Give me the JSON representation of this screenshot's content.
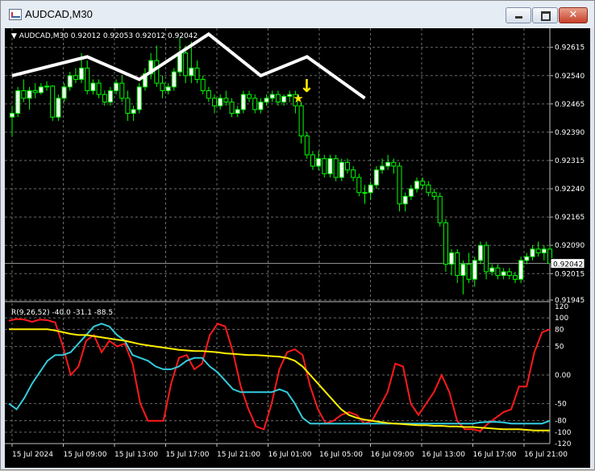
{
  "window": {
    "title": "AUDCAD,M30",
    "close_glyph": "✕"
  },
  "chart_data": [
    {
      "type": "candlestick",
      "symbol_header": "AUDCAD,M30  0.92012 0.92053 0.92012 0.92042",
      "current_price": "0.92042",
      "price_ticks": [
        "0.92615",
        "0.92540",
        "0.92465",
        "0.92390",
        "0.92315",
        "0.92240",
        "0.92165",
        "0.92090",
        "0.92015",
        "0.91945"
      ],
      "ylim": [
        0.91945,
        0.92655
      ],
      "up_color": "#ffffff",
      "down_color": "#000000",
      "wick_color": "#00ff00",
      "candles_ohlc": [
        [
          0.9243,
          0.9246,
          0.9238,
          0.9244
        ],
        [
          0.9244,
          0.9251,
          0.9243,
          0.925
        ],
        [
          0.925,
          0.9253,
          0.9247,
          0.9248
        ],
        [
          0.9248,
          0.9251,
          0.9245,
          0.925
        ],
        [
          0.925,
          0.9252,
          0.9248,
          0.92495
        ],
        [
          0.92495,
          0.9252,
          0.9249,
          0.9251
        ],
        [
          0.9251,
          0.92525,
          0.925,
          0.92512
        ],
        [
          0.92512,
          0.92515,
          0.9242,
          0.9243
        ],
        [
          0.9243,
          0.9249,
          0.9242,
          0.9248
        ],
        [
          0.9248,
          0.9252,
          0.9247,
          0.9251
        ],
        [
          0.9251,
          0.9255,
          0.925,
          0.9254
        ],
        [
          0.9254,
          0.9256,
          0.9252,
          0.9253
        ],
        [
          0.9253,
          0.926,
          0.9252,
          0.9256
        ],
        [
          0.9256,
          0.9258,
          0.9249,
          0.925
        ],
        [
          0.925,
          0.9253,
          0.9249,
          0.9252
        ],
        [
          0.9252,
          0.9253,
          0.9248,
          0.9249
        ],
        [
          0.9249,
          0.925,
          0.9246,
          0.9247
        ],
        [
          0.9247,
          0.9251,
          0.9246,
          0.925
        ],
        [
          0.925,
          0.9253,
          0.9249,
          0.9252
        ],
        [
          0.9252,
          0.9254,
          0.9247,
          0.9248
        ],
        [
          0.9248,
          0.925,
          0.9242,
          0.9244
        ],
        [
          0.9244,
          0.9246,
          0.9242,
          0.9245
        ],
        [
          0.9245,
          0.9252,
          0.9244,
          0.9251
        ],
        [
          0.9251,
          0.9256,
          0.925,
          0.92545
        ],
        [
          0.92545,
          0.926,
          0.9253,
          0.9258
        ],
        [
          0.9258,
          0.9262,
          0.9251,
          0.9252
        ],
        [
          0.9252,
          0.9254,
          0.9248,
          0.925
        ],
        [
          0.925,
          0.9252,
          0.9249,
          0.9251
        ],
        [
          0.9251,
          0.9256,
          0.925,
          0.9255
        ],
        [
          0.9255,
          0.9264,
          0.9254,
          0.926
        ],
        [
          0.926,
          0.9262,
          0.9252,
          0.9254
        ],
        [
          0.9254,
          0.9263,
          0.9252,
          0.9256
        ],
        [
          0.9256,
          0.9258,
          0.9252,
          0.9253
        ],
        [
          0.9253,
          0.9254,
          0.9249,
          0.925
        ],
        [
          0.925,
          0.9251,
          0.9247,
          0.9248
        ],
        [
          0.9248,
          0.9249,
          0.9244,
          0.9246
        ],
        [
          0.9246,
          0.9249,
          0.9245,
          0.9248
        ],
        [
          0.9248,
          0.925,
          0.9246,
          0.9247
        ],
        [
          0.9247,
          0.9248,
          0.9243,
          0.9244
        ],
        [
          0.9244,
          0.9246,
          0.9243,
          0.9245
        ],
        [
          0.9245,
          0.925,
          0.9244,
          0.9249
        ],
        [
          0.9249,
          0.925,
          0.9247,
          0.9248
        ],
        [
          0.9248,
          0.9249,
          0.9244,
          0.9245
        ],
        [
          0.9245,
          0.9248,
          0.9244,
          0.9247
        ],
        [
          0.9247,
          0.9249,
          0.9246,
          0.9248
        ],
        [
          0.9248,
          0.925,
          0.9247,
          0.9249
        ],
        [
          0.9249,
          0.925,
          0.9246,
          0.9247
        ],
        [
          0.9247,
          0.9249,
          0.9246,
          0.92485
        ],
        [
          0.92485,
          0.925,
          0.9247,
          0.9249
        ],
        [
          0.9249,
          0.925,
          0.9244,
          0.9246
        ],
        [
          0.9246,
          0.9247,
          0.9236,
          0.9238
        ],
        [
          0.9238,
          0.9239,
          0.9232,
          0.9233
        ],
        [
          0.9233,
          0.9234,
          0.9229,
          0.923
        ],
        [
          0.923,
          0.9234,
          0.9229,
          0.9232
        ],
        [
          0.9232,
          0.9233,
          0.9227,
          0.9228
        ],
        [
          0.9228,
          0.9233,
          0.9227,
          0.9232
        ],
        [
          0.9232,
          0.9233,
          0.9226,
          0.9227
        ],
        [
          0.9227,
          0.9232,
          0.9226,
          0.9231
        ],
        [
          0.9231,
          0.9232,
          0.9228,
          0.9229
        ],
        [
          0.9229,
          0.923,
          0.9226,
          0.9227
        ],
        [
          0.9227,
          0.9228,
          0.9222,
          0.9223
        ],
        [
          0.9223,
          0.9225,
          0.922,
          0.9223
        ],
        [
          0.9223,
          0.9226,
          0.9221,
          0.9225
        ],
        [
          0.9225,
          0.923,
          0.9224,
          0.9229
        ],
        [
          0.9229,
          0.9232,
          0.9228,
          0.923
        ],
        [
          0.923,
          0.9233,
          0.9229,
          0.9231
        ],
        [
          0.9231,
          0.9232,
          0.9228,
          0.923
        ],
        [
          0.923,
          0.9231,
          0.9218,
          0.922
        ],
        [
          0.922,
          0.9223,
          0.9218,
          0.9222
        ],
        [
          0.9222,
          0.9225,
          0.9221,
          0.9224
        ],
        [
          0.9224,
          0.9227,
          0.9223,
          0.9226
        ],
        [
          0.9226,
          0.9227,
          0.9224,
          0.9225
        ],
        [
          0.9225,
          0.9226,
          0.9222,
          0.9223
        ],
        [
          0.9223,
          0.9224,
          0.9221,
          0.9222
        ],
        [
          0.9222,
          0.9223,
          0.9214,
          0.9215
        ],
        [
          0.9215,
          0.9216,
          0.9202,
          0.9204
        ],
        [
          0.9204,
          0.9208,
          0.9201,
          0.9207
        ],
        [
          0.9207,
          0.9208,
          0.9199,
          0.9201
        ],
        [
          0.9201,
          0.9205,
          0.9196,
          0.9204
        ],
        [
          0.9204,
          0.9207,
          0.9199,
          0.92
        ],
        [
          0.92,
          0.9206,
          0.9198,
          0.9205
        ],
        [
          0.9205,
          0.921,
          0.9204,
          0.9209
        ],
        [
          0.9209,
          0.921,
          0.92,
          0.9202
        ],
        [
          0.9202,
          0.9204,
          0.9201,
          0.9203
        ],
        [
          0.9203,
          0.9204,
          0.92,
          0.9201
        ],
        [
          0.9201,
          0.9203,
          0.92,
          0.9202
        ],
        [
          0.9202,
          0.9203,
          0.92,
          0.9201
        ],
        [
          0.9201,
          0.9202,
          0.9199,
          0.92
        ],
        [
          0.92,
          0.9206,
          0.9199,
          0.9205
        ],
        [
          0.9205,
          0.9207,
          0.9204,
          0.9206
        ],
        [
          0.9206,
          0.9209,
          0.9205,
          0.9208
        ],
        [
          0.9208,
          0.921,
          0.9206,
          0.9207
        ],
        [
          0.9207,
          0.9209,
          0.9205,
          0.9208
        ],
        [
          0.9208,
          0.9209,
          0.9204,
          0.92042
        ]
      ]
    },
    {
      "type": "line",
      "indicator_header": "R(9,26,52) -40.0 -31.1 -88.5",
      "ticks": [
        "120",
        "100",
        "80",
        "50",
        "0.00",
        "-50",
        "-80",
        "-100",
        "-120"
      ],
      "tick_values": [
        120,
        100,
        80,
        50,
        0,
        -50,
        -80,
        -100,
        -120
      ],
      "ylim": [
        -120,
        120
      ],
      "x_labels": [
        "15 Jul 2024",
        "15 Jul 09:00",
        "15 Jul 13:00",
        "15 Jul 17:00",
        "15 Jul 21:00",
        "16 Jul 01:00",
        "16 Jul 05:00",
        "16 Jul 09:00",
        "16 Jul 13:00",
        "16 Jul 17:00",
        "16 Jul 21:00"
      ],
      "series": [
        {
          "color": "#ff1a1a",
          "values": [
            95,
            98,
            97,
            93,
            97,
            96,
            92,
            50,
            0,
            15,
            60,
            70,
            40,
            60,
            50,
            55,
            20,
            -50,
            -80,
            -80,
            -80,
            -15,
            30,
            35,
            10,
            20,
            70,
            90,
            85,
            40,
            -20,
            -60,
            -90,
            -95,
            -50,
            10,
            40,
            45,
            35,
            -20,
            -60,
            -85,
            -80,
            -70,
            -65,
            -70,
            -85,
            -80,
            -55,
            -30,
            20,
            15,
            -50,
            -70,
            -50,
            -30,
            0,
            -30,
            -80,
            -95,
            -95,
            -98,
            -85,
            -75,
            -65,
            -60,
            -20,
            -20,
            40,
            75,
            80
          ]
        },
        {
          "color": "#33ccdd",
          "values": [
            -50,
            -60,
            -40,
            -15,
            5,
            25,
            35,
            35,
            40,
            55,
            70,
            85,
            90,
            85,
            70,
            60,
            35,
            30,
            25,
            15,
            10,
            10,
            15,
            25,
            30,
            30,
            15,
            5,
            -10,
            -25,
            -30,
            -30,
            -30,
            -30,
            -30,
            -25,
            -30,
            -50,
            -75,
            -85,
            -85,
            -85,
            -85,
            -85,
            -85,
            -85,
            -85,
            -85,
            -85,
            -85,
            -85,
            -85,
            -85,
            -85,
            -85,
            -85,
            -85,
            -85,
            -85,
            -85,
            -85,
            -83,
            -82,
            -82,
            -83,
            -85,
            -85,
            -85,
            -85,
            -85,
            -80
          ]
        },
        {
          "color": "#ffee00",
          "values": [
            80,
            80,
            80,
            80,
            80,
            80,
            78,
            75,
            72,
            70,
            70,
            68,
            66,
            64,
            62,
            60,
            57,
            54,
            52,
            50,
            48,
            46,
            44,
            43,
            42,
            42,
            41,
            40,
            38,
            37,
            36,
            35,
            35,
            34,
            33,
            32,
            30,
            25,
            15,
            0,
            -15,
            -30,
            -45,
            -60,
            -70,
            -75,
            -78,
            -80,
            -82,
            -84,
            -85,
            -86,
            -87,
            -88,
            -88,
            -89,
            -89,
            -90,
            -90,
            -91,
            -91,
            -92,
            -93,
            -94,
            -95,
            -95,
            -95,
            -96,
            -97,
            -97,
            -97
          ]
        }
      ]
    }
  ],
  "drawing": {
    "zigzag_color": "#ffffff",
    "zigzag_points": [
      [
        0,
        0.9254
      ],
      [
        13,
        0.9259
      ],
      [
        22,
        0.9253
      ],
      [
        34,
        0.9265
      ],
      [
        43,
        0.9254
      ],
      [
        51,
        0.9259
      ],
      [
        61,
        0.9248
      ]
    ],
    "arrow_color": "#ffee00",
    "star_glyph": "★",
    "arrow_glyph": "↓"
  }
}
